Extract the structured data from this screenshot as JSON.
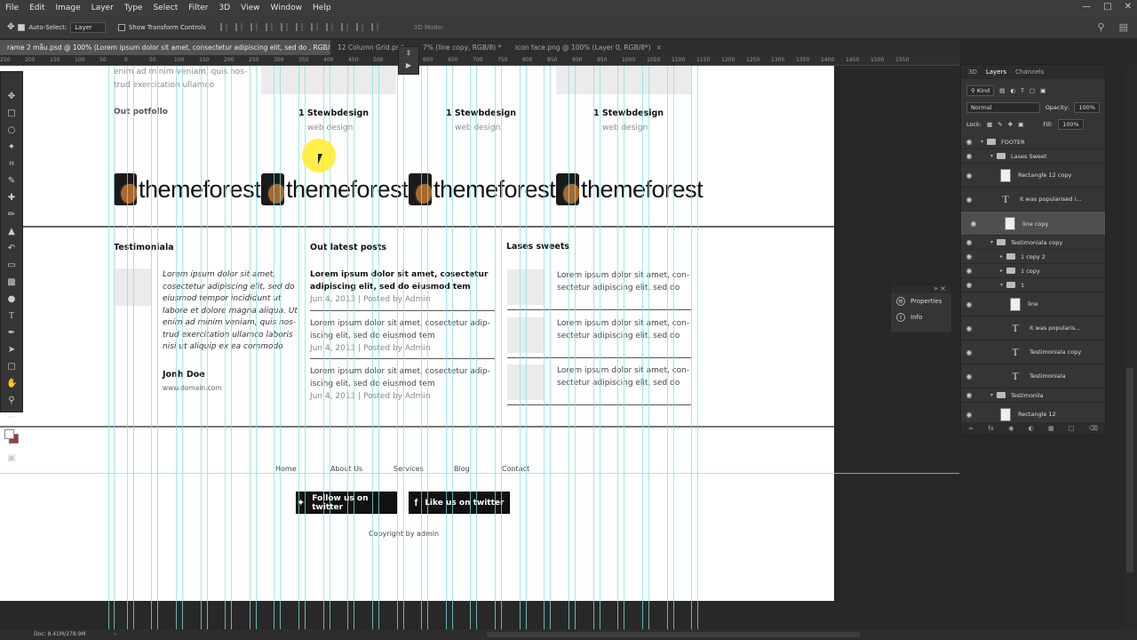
{
  "menu": [
    "File",
    "Edit",
    "Image",
    "Layer",
    "Type",
    "Select",
    "Filter",
    "3D",
    "View",
    "Window",
    "Help"
  ],
  "options": {
    "auto_select_label": "Auto-Select:",
    "auto_select_value": "Layer",
    "transform_label": "Show Transform Controls",
    "mode_3d": "3D Mode:"
  },
  "tabs": [
    {
      "label": "rame 2 mẫu.psd @ 100% (Lorem ipsum dolor sit amet, consectetur adipiscing elit, sed do , RGB/8) *",
      "active": true
    },
    {
      "label": "12 Column Grid.psd",
      "active": false
    },
    {
      "label": "7% (line copy, RGB/8) *",
      "active": false
    },
    {
      "label": "icon face.png @ 100% (Layer 0, RGB/8*)",
      "active": false
    }
  ],
  "ruler": [
    "250",
    "200",
    "150",
    "100",
    "50",
    "0",
    "50",
    "100",
    "150",
    "200",
    "250",
    "300",
    "350",
    "400",
    "450",
    "500",
    "550",
    "600",
    "650",
    "700",
    "750",
    "800",
    "850",
    "900",
    "950",
    "1000",
    "1050",
    "1100",
    "1150",
    "1200",
    "1250",
    "1300",
    "1350",
    "1400",
    "1450",
    "1500",
    "1550"
  ],
  "page": {
    "intro_line1": "enim ad minim veniam, quis nos-",
    "intro_line2": "trud exercitation ullamco",
    "portfolio_title": "Out potfollo",
    "portfolio_items": [
      {
        "title": "1 Stewbdesign",
        "sub": "web design"
      },
      {
        "title": "1 Stewbdesign",
        "sub": "web design"
      },
      {
        "title": "1 Stewbdesign",
        "sub": "web design"
      }
    ],
    "logo_word": "themeforest",
    "testimonial": {
      "title": "Testimoniala",
      "quote": [
        "Lorem ipsum dolor sit amet,",
        "cosectetur adipiscing elit, sed do",
        "eiusmod tempor incididunt ut",
        "labore et dolore magna aliqua. Ut",
        "enim ad minim veniam, quis nos-",
        "trud exercitation ullamco laboris",
        "nisi ut aliquip ex ea commodo"
      ],
      "author": "Jonh Doe",
      "domain": "www.domain.com"
    },
    "posts": {
      "title": "Out latest posts",
      "items": [
        {
          "l1": "Lorem ipsum dolor sit amet, cosectetur",
          "l2": "adipiscing elit, sed do eiusmod tem",
          "meta": "Jun 4, 2013 | Posted by Admin",
          "bold": true
        },
        {
          "l1": "Lorem ipsum dolor sit amet, cosectetur adip-",
          "l2": "iscing elit, sed do eiusmod tem",
          "meta": "Jun 4, 2013 | Posted by Admin",
          "bold": false
        },
        {
          "l1": "Lorem ipsum dolor sit amet, cosectetur adip-",
          "l2": "iscing elit, sed do eiusmod tem",
          "meta": "Jun 4, 2013 | Posted by Admin",
          "bold": false
        }
      ]
    },
    "sweets": {
      "title": "Lases sweets",
      "items": [
        {
          "l1": "Lorem ipsum dolor sit amet, con-",
          "l2": "sectetur adipiscing elit, sed do"
        },
        {
          "l1": "Lorem ipsum dolor sit amet, con-",
          "l2": "sectetur adipiscing elit, sed do"
        },
        {
          "l1": "Lorem ipsum dolor sit amet, con-",
          "l2": "sectetur adipiscing elit, sed do"
        }
      ]
    },
    "footer_nav": [
      "Home",
      "About Us",
      "Services",
      "Blog",
      "Contact"
    ],
    "twitter_button": "Follow us on twitter",
    "facebook_button": "Like us on twitter",
    "copyright": "Copyright by admin"
  },
  "mini_panel": {
    "properties": "Properties",
    "info": "Info"
  },
  "layers_panel": {
    "tabs": [
      "3D",
      "Layers",
      "Channels"
    ],
    "kind": "Kind",
    "blend": "Normal",
    "opacity_label": "Opacity:",
    "opacity": "100%",
    "lock_label": "Lock:",
    "fill_label": "Fill:",
    "fill": "100%",
    "layers": [
      {
        "name": "FOOTER",
        "type": "folder",
        "indent": 0,
        "open": true
      },
      {
        "name": "Lases Sweet",
        "type": "folder",
        "indent": 1,
        "open": true
      },
      {
        "name": "Rectangle 12 copy",
        "type": "image",
        "indent": 2
      },
      {
        "name": "It was popularised i...",
        "type": "text",
        "indent": 2
      },
      {
        "name": "line copy",
        "type": "image",
        "indent": 2,
        "selected": true
      },
      {
        "name": "Testimoniala copy",
        "type": "folder",
        "indent": 1,
        "open": true
      },
      {
        "name": "1 copy 2",
        "type": "folder",
        "indent": 2,
        "open": false
      },
      {
        "name": "1 copy",
        "type": "folder",
        "indent": 2,
        "open": false
      },
      {
        "name": "1",
        "type": "folder",
        "indent": 2,
        "open": true
      },
      {
        "name": "line",
        "type": "image",
        "indent": 3
      },
      {
        "name": "It was popularis...",
        "type": "text",
        "indent": 3
      },
      {
        "name": "Testimoniala copy",
        "type": "text",
        "indent": 3
      },
      {
        "name": "Testimoniala",
        "type": "text",
        "indent": 3
      },
      {
        "name": "Testimonila",
        "type": "folder",
        "indent": 1,
        "open": true
      },
      {
        "name": "Rectangle 12",
        "type": "image",
        "indent": 2
      }
    ]
  },
  "status": {
    "doc": "Doc: 8.41M/278.9M"
  }
}
